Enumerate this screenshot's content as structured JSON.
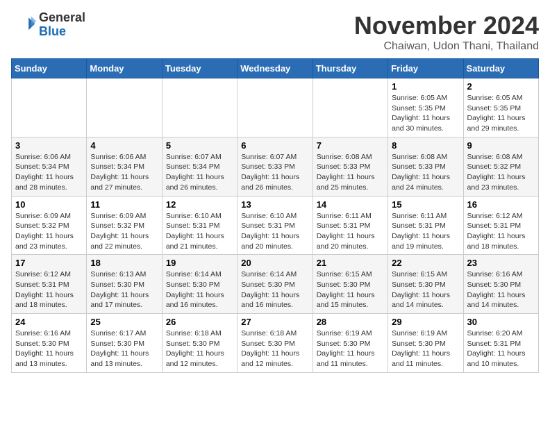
{
  "logo": {
    "general": "General",
    "blue": "Blue"
  },
  "header": {
    "month": "November 2024",
    "location": "Chaiwan, Udon Thani, Thailand"
  },
  "days_of_week": [
    "Sunday",
    "Monday",
    "Tuesday",
    "Wednesday",
    "Thursday",
    "Friday",
    "Saturday"
  ],
  "weeks": [
    [
      {
        "day": "",
        "info": ""
      },
      {
        "day": "",
        "info": ""
      },
      {
        "day": "",
        "info": ""
      },
      {
        "day": "",
        "info": ""
      },
      {
        "day": "",
        "info": ""
      },
      {
        "day": "1",
        "info": "Sunrise: 6:05 AM\nSunset: 5:35 PM\nDaylight: 11 hours\nand 30 minutes."
      },
      {
        "day": "2",
        "info": "Sunrise: 6:05 AM\nSunset: 5:35 PM\nDaylight: 11 hours\nand 29 minutes."
      }
    ],
    [
      {
        "day": "3",
        "info": "Sunrise: 6:06 AM\nSunset: 5:34 PM\nDaylight: 11 hours\nand 28 minutes."
      },
      {
        "day": "4",
        "info": "Sunrise: 6:06 AM\nSunset: 5:34 PM\nDaylight: 11 hours\nand 27 minutes."
      },
      {
        "day": "5",
        "info": "Sunrise: 6:07 AM\nSunset: 5:34 PM\nDaylight: 11 hours\nand 26 minutes."
      },
      {
        "day": "6",
        "info": "Sunrise: 6:07 AM\nSunset: 5:33 PM\nDaylight: 11 hours\nand 26 minutes."
      },
      {
        "day": "7",
        "info": "Sunrise: 6:08 AM\nSunset: 5:33 PM\nDaylight: 11 hours\nand 25 minutes."
      },
      {
        "day": "8",
        "info": "Sunrise: 6:08 AM\nSunset: 5:33 PM\nDaylight: 11 hours\nand 24 minutes."
      },
      {
        "day": "9",
        "info": "Sunrise: 6:08 AM\nSunset: 5:32 PM\nDaylight: 11 hours\nand 23 minutes."
      }
    ],
    [
      {
        "day": "10",
        "info": "Sunrise: 6:09 AM\nSunset: 5:32 PM\nDaylight: 11 hours\nand 23 minutes."
      },
      {
        "day": "11",
        "info": "Sunrise: 6:09 AM\nSunset: 5:32 PM\nDaylight: 11 hours\nand 22 minutes."
      },
      {
        "day": "12",
        "info": "Sunrise: 6:10 AM\nSunset: 5:31 PM\nDaylight: 11 hours\nand 21 minutes."
      },
      {
        "day": "13",
        "info": "Sunrise: 6:10 AM\nSunset: 5:31 PM\nDaylight: 11 hours\nand 20 minutes."
      },
      {
        "day": "14",
        "info": "Sunrise: 6:11 AM\nSunset: 5:31 PM\nDaylight: 11 hours\nand 20 minutes."
      },
      {
        "day": "15",
        "info": "Sunrise: 6:11 AM\nSunset: 5:31 PM\nDaylight: 11 hours\nand 19 minutes."
      },
      {
        "day": "16",
        "info": "Sunrise: 6:12 AM\nSunset: 5:31 PM\nDaylight: 11 hours\nand 18 minutes."
      }
    ],
    [
      {
        "day": "17",
        "info": "Sunrise: 6:12 AM\nSunset: 5:31 PM\nDaylight: 11 hours\nand 18 minutes."
      },
      {
        "day": "18",
        "info": "Sunrise: 6:13 AM\nSunset: 5:30 PM\nDaylight: 11 hours\nand 17 minutes."
      },
      {
        "day": "19",
        "info": "Sunrise: 6:14 AM\nSunset: 5:30 PM\nDaylight: 11 hours\nand 16 minutes."
      },
      {
        "day": "20",
        "info": "Sunrise: 6:14 AM\nSunset: 5:30 PM\nDaylight: 11 hours\nand 16 minutes."
      },
      {
        "day": "21",
        "info": "Sunrise: 6:15 AM\nSunset: 5:30 PM\nDaylight: 11 hours\nand 15 minutes."
      },
      {
        "day": "22",
        "info": "Sunrise: 6:15 AM\nSunset: 5:30 PM\nDaylight: 11 hours\nand 14 minutes."
      },
      {
        "day": "23",
        "info": "Sunrise: 6:16 AM\nSunset: 5:30 PM\nDaylight: 11 hours\nand 14 minutes."
      }
    ],
    [
      {
        "day": "24",
        "info": "Sunrise: 6:16 AM\nSunset: 5:30 PM\nDaylight: 11 hours\nand 13 minutes."
      },
      {
        "day": "25",
        "info": "Sunrise: 6:17 AM\nSunset: 5:30 PM\nDaylight: 11 hours\nand 13 minutes."
      },
      {
        "day": "26",
        "info": "Sunrise: 6:18 AM\nSunset: 5:30 PM\nDaylight: 11 hours\nand 12 minutes."
      },
      {
        "day": "27",
        "info": "Sunrise: 6:18 AM\nSunset: 5:30 PM\nDaylight: 11 hours\nand 12 minutes."
      },
      {
        "day": "28",
        "info": "Sunrise: 6:19 AM\nSunset: 5:30 PM\nDaylight: 11 hours\nand 11 minutes."
      },
      {
        "day": "29",
        "info": "Sunrise: 6:19 AM\nSunset: 5:30 PM\nDaylight: 11 hours\nand 11 minutes."
      },
      {
        "day": "30",
        "info": "Sunrise: 6:20 AM\nSunset: 5:31 PM\nDaylight: 11 hours\nand 10 minutes."
      }
    ]
  ]
}
